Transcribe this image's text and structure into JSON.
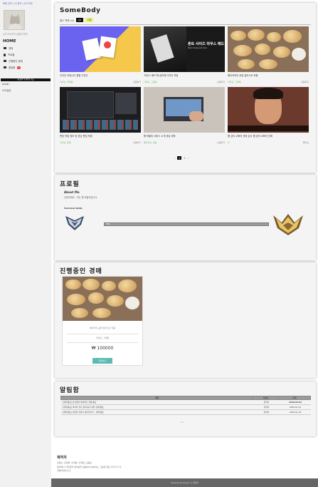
{
  "sidebar": {
    "topnav": {
      "a": "회원 관리",
      "b": "내 정보",
      "c": "로그아웃"
    },
    "userinfo": "님지구로모의 홈페이지에",
    "home": "HOME",
    "items": [
      {
        "label": "경매"
      },
      {
        "label": "프로필"
      },
      {
        "label": "진행중인 경매"
      },
      {
        "label": "알림함",
        "badge": "3"
      }
    ],
    "blackbar": "홈 클릭 토지안녕 오늘",
    "small1": "ROWE ...",
    "small2": "쓰고싶은"
  },
  "portfolio": {
    "title": "SomeBody",
    "filter_label": "필드 목록 ver",
    "filter_all": "All",
    "filter_ko": "디자",
    "cards": [
      {
        "title": "디자인 커뮤니티 명함 디자인",
        "tag": "디자인, 마케팅",
        "by": "신청하기"
      },
      {
        "title": "'마우스 패드'에 굽이에 디자인 작업",
        "tag": "디자인, 그래픽",
        "by": "신청하기"
      },
      {
        "title": "베이커리의 공업 일러스트 작품",
        "tag": "디자인, 그래픽",
        "by": "신청하기"
      },
      {
        "title": "편집 작업 정보 된 영상 편집 작업",
        "tag": "디자인, 편집",
        "by": "신청하기"
      },
      {
        "title": "웹 퍼블리 서비스 소개 영상 제작",
        "tag": "웹디자인, 영상",
        "by": "신청하기"
      },
      {
        "title": "웹 강의 교육의 진짜 강사 웹 강의 교육이 진짜",
        "tag": "IT",
        "by": "좋아요"
      }
    ],
    "pager": [
      "‹",
      "1",
      "2",
      "›"
    ],
    "t2_main": "혼트 사이즈 마우스 패드",
    "t2_sub": "Best mouse pad here"
  },
  "profile": {
    "title": "프로필",
    "about_heading": "About Me",
    "about_text": "안녕하세요 , 저는 웹 개발자입니다.",
    "skills_heading": "Technical Skills",
    "bar_label": "78%"
  },
  "auction": {
    "title": "진행중인 경매",
    "item_title": "베이커리 공업 일러스트 작품",
    "item_tag": "디자인, 그래픽",
    "price": "₩ 100000",
    "button": "입찰하기"
  },
  "notice": {
    "title": "알림함",
    "headers": [
      "제목",
      "작성자",
      "날짜"
    ],
    "rows": [
      {
        "title": "[경매 종료] 당신께서 작성하신 경매 종료",
        "author": "관리자",
        "date": "2020-02-03"
      },
      {
        "title": "[경매 종료] 마지막 경기 참여 증가 대한 경매 종료",
        "author": "관리자",
        "date": "2020-01-22"
      },
      {
        "title": "[경매 종료] 관련된 판정가 증가합니다 ‑ 경매 종료",
        "author": "관리자",
        "date": "2020-01-18"
      }
    ],
    "pager": "‹ 1 ›"
  },
  "footer": {
    "heading": "제작자",
    "line1": "민종인, 유재화, 이태웅, 차재영, 김동윤",
    "line2": "팬에게서 저작권을 일부분을 활용하여 봉하하는 그분에 제공 가져가기 이",
    "line3": "개발하였습니다.",
    "bottom": "Powered by Koyeb co 운영권"
  }
}
